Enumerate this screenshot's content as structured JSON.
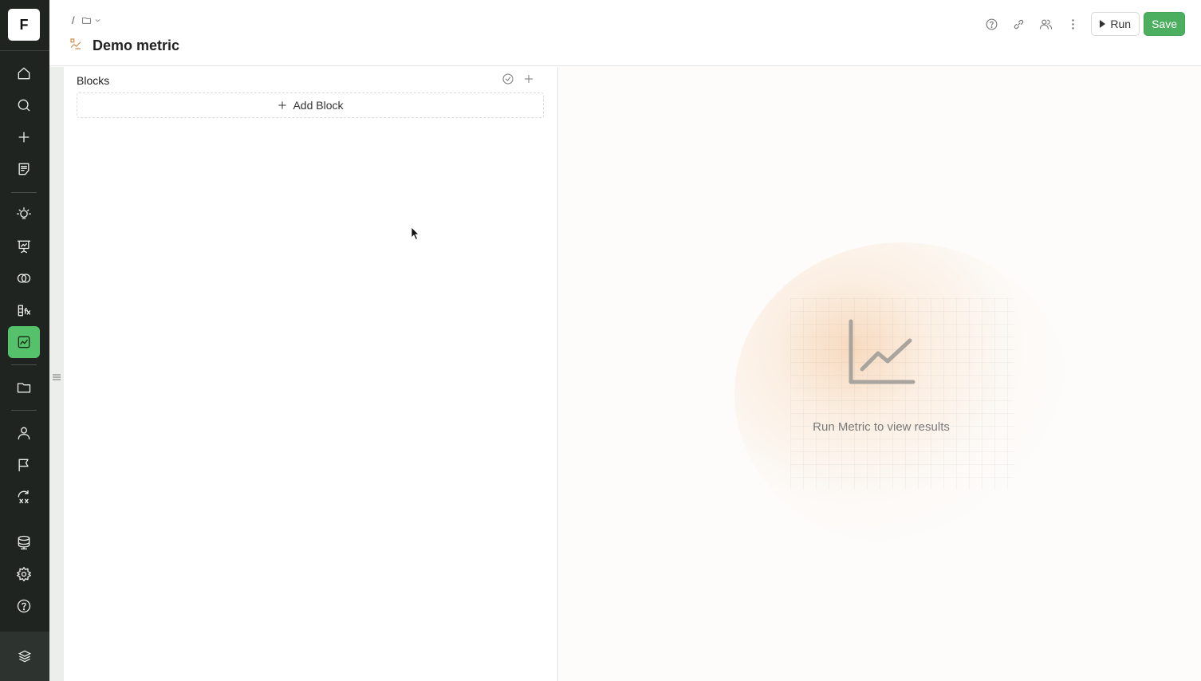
{
  "sidebar": {
    "logo": "F",
    "items": [
      {
        "icon": "home-icon"
      },
      {
        "icon": "search-icon"
      },
      {
        "icon": "plus-icon"
      },
      {
        "icon": "notes-icon"
      },
      {
        "icon": "lightbulb-icon"
      },
      {
        "icon": "presentation-icon"
      },
      {
        "icon": "overlap-circles-icon"
      },
      {
        "icon": "formula-icon"
      },
      {
        "icon": "metric-chart-icon",
        "active": true
      },
      {
        "icon": "folder-icon"
      },
      {
        "icon": "user-icon"
      },
      {
        "icon": "flag-icon"
      },
      {
        "icon": "transform-icon"
      },
      {
        "icon": "database-icon"
      },
      {
        "icon": "gear-icon"
      },
      {
        "icon": "help-icon"
      }
    ],
    "bottom_icon": "stack-icon",
    "accent_color": "#55c16b"
  },
  "header": {
    "breadcrumb_separator": "/",
    "title": "Demo metric",
    "run_label": "Run",
    "save_label": "Save",
    "save_color": "#4caf5f"
  },
  "blocks": {
    "title": "Blocks",
    "add_label": "Add Block"
  },
  "results": {
    "message": "Run Metric to view results"
  }
}
